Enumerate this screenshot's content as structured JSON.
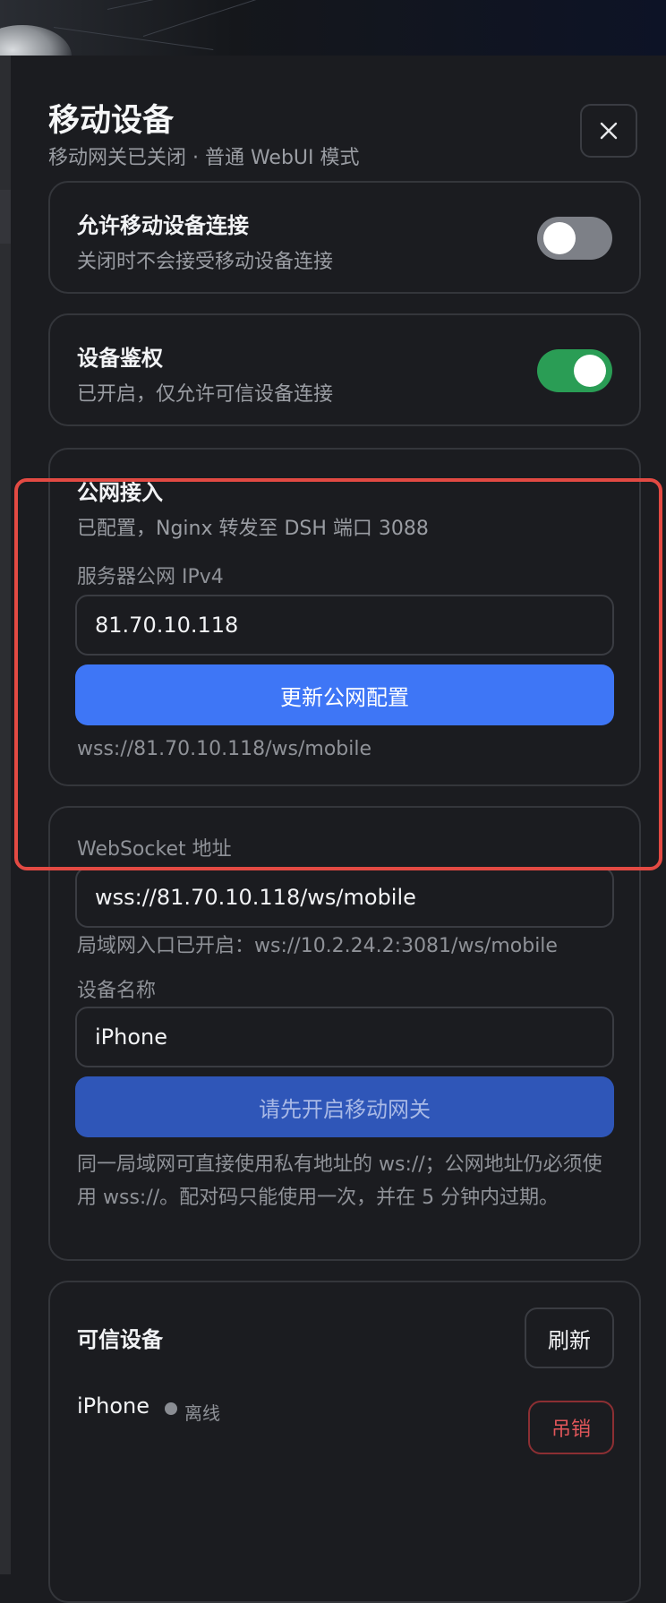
{
  "header": {
    "title": "移动设备",
    "subtitle": "移动网关已关闭 · 普通 WebUI 模式"
  },
  "allow_connection": {
    "title": "允许移动设备连接",
    "description": "关闭时不会接受移动设备连接",
    "enabled": false
  },
  "device_auth": {
    "title": "设备鉴权",
    "description": "已开启，仅允许可信设备连接",
    "enabled": true
  },
  "public_access": {
    "title": "公网接入",
    "description": "已配置，Nginx 转发至 DSH 端口 3088",
    "ip_label": "服务器公网 IPv4",
    "ip_value": "81.70.10.118",
    "update_button": "更新公网配置",
    "ws_url": "wss://81.70.10.118/ws/mobile"
  },
  "connection": {
    "websocket_label": "WebSocket 地址",
    "websocket_value": "wss://81.70.10.118/ws/mobile",
    "lan_hint": "局域网入口已开启：ws://10.2.24.2:3081/ws/mobile",
    "device_name_label": "设备名称",
    "device_name_value": "iPhone",
    "gateway_button": "请先开启移动网关",
    "note": "同一局域网可直接使用私有地址的 ws://；公网地址仍必须使用 wss://。配对码只能使用一次，并在 5 分钟内过期。"
  },
  "trusted_devices": {
    "title": "可信设备",
    "refresh_button": "刷新",
    "devices": [
      {
        "name": "iPhone",
        "status": "离线",
        "revoke_label": "吊销"
      }
    ]
  },
  "colors": {
    "accent": "#3e76f6",
    "toggle_on": "#2a9d55",
    "highlight": "#e34a43",
    "danger": "#e0565a"
  }
}
